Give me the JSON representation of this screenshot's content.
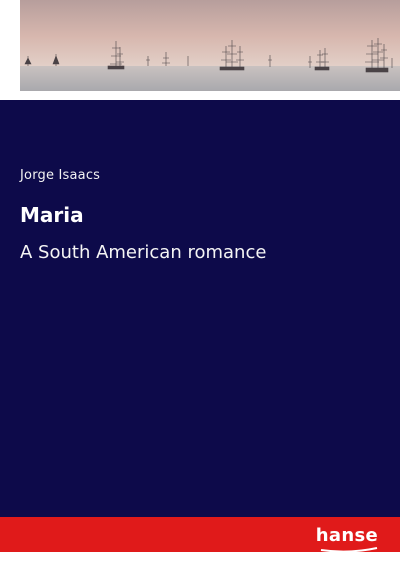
{
  "book": {
    "author": "Jorge Isaacs",
    "title": "Maria",
    "subtitle": "A South American romance"
  },
  "publisher": {
    "logo_text": "hanse"
  },
  "colors": {
    "panel": "#0d0a4a",
    "footer": "#e01a1a",
    "sky": "#c9a9a3",
    "sea": "#b8b8b8"
  },
  "icons": {
    "cover_image": "tall-ships-at-sea-photo",
    "publisher_logo": "hanse-logo"
  }
}
